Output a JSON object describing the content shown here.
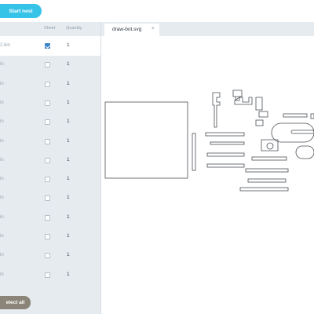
{
  "toolbar": {
    "start_nest_label": "Start nest"
  },
  "parts_table": {
    "headers": {
      "sheet": "Sheet",
      "quantity": "Quantity"
    },
    "rows": [
      {
        "size": "2.6in",
        "sheet": true,
        "quantity": "1"
      },
      {
        "size": "in",
        "sheet": false,
        "quantity": "1"
      },
      {
        "size": "in",
        "sheet": false,
        "quantity": "1"
      },
      {
        "size": "in",
        "sheet": false,
        "quantity": "1"
      },
      {
        "size": "in",
        "sheet": false,
        "quantity": "1"
      },
      {
        "size": "in",
        "sheet": false,
        "quantity": "1"
      },
      {
        "size": "in",
        "sheet": false,
        "quantity": "1"
      },
      {
        "size": "in",
        "sheet": false,
        "quantity": "1"
      },
      {
        "size": "in",
        "sheet": false,
        "quantity": "1"
      },
      {
        "size": "in",
        "sheet": false,
        "quantity": "1"
      },
      {
        "size": "in",
        "sheet": false,
        "quantity": "1"
      },
      {
        "size": "in",
        "sheet": false,
        "quantity": "1"
      },
      {
        "size": "in",
        "sheet": false,
        "quantity": "1"
      }
    ],
    "select_all_label": "elect all"
  },
  "tabs": [
    {
      "label": "draw-bot.svg",
      "close": "×"
    }
  ],
  "colors": {
    "accent": "#35c3e8",
    "panel": "#e6ebef",
    "select_all": "#8a8578",
    "checkbox": "#3b82c6"
  }
}
